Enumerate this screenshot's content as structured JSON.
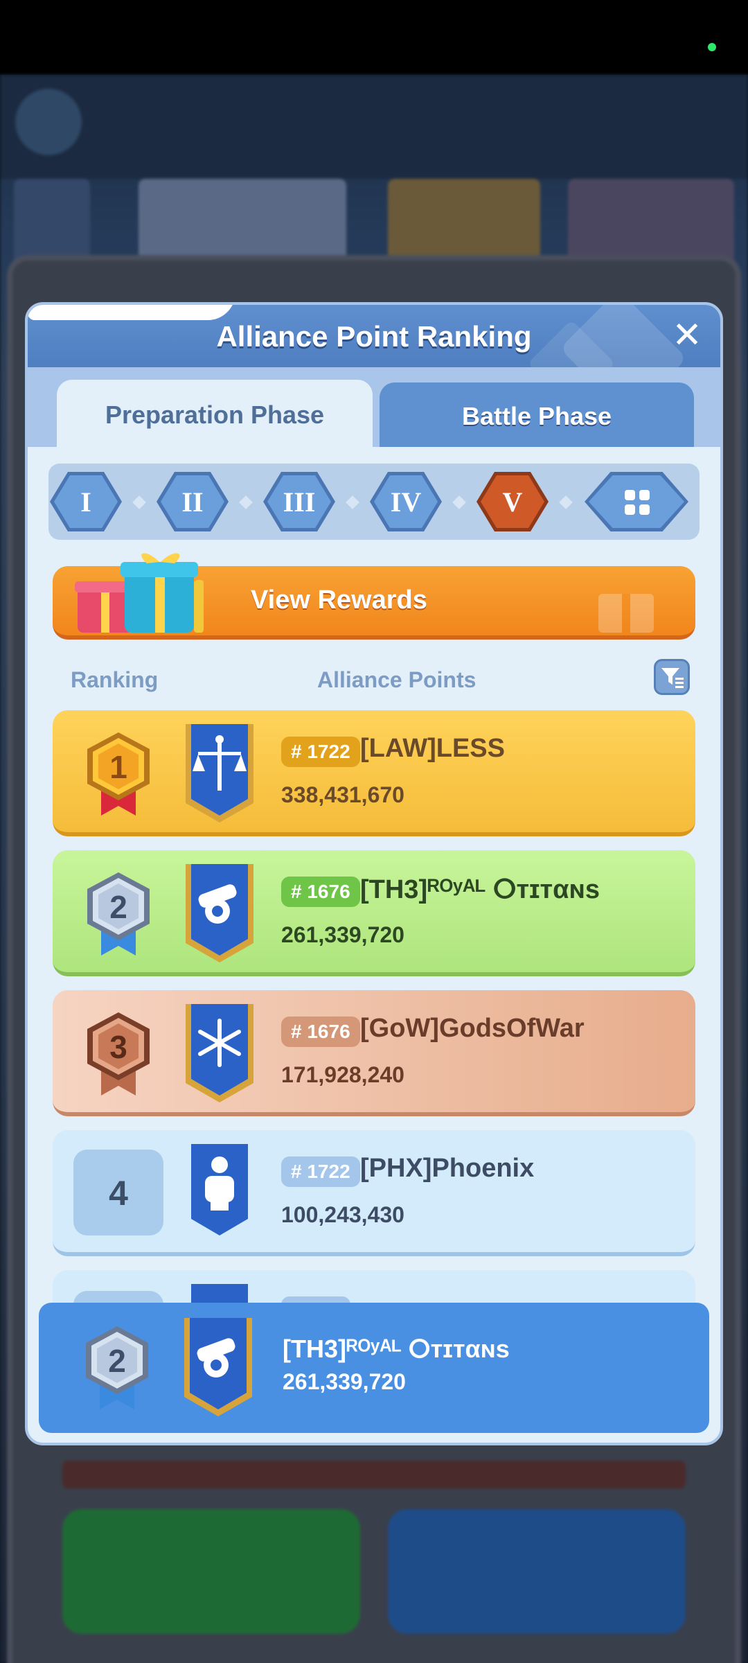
{
  "modal": {
    "title": "Alliance Point Ranking",
    "close_label": "✕"
  },
  "tabs": [
    {
      "label": "Preparation Phase",
      "active": true
    },
    {
      "label": "Battle Phase",
      "active": false
    }
  ],
  "tiers": [
    {
      "label": "I",
      "active": false
    },
    {
      "label": "II",
      "active": false
    },
    {
      "label": "III",
      "active": false
    },
    {
      "label": "IV",
      "active": false
    },
    {
      "label": "V",
      "active": true
    },
    {
      "label": "grid",
      "icon": "grid-icon",
      "active": false
    }
  ],
  "rewards_button": {
    "label": "View Rewards"
  },
  "columns": {
    "ranking": "Ranking",
    "points": "Alliance Points"
  },
  "rows": [
    {
      "rank": "1",
      "server": "# 1722",
      "name": "[LAW]LESS",
      "points": "338,431,670",
      "emblem": "scales-banner-icon"
    },
    {
      "rank": "2",
      "server": "# 1676",
      "name": "[TH3]ᴿᴼʸᴬᴸ ⵔтɪтαɴѕ",
      "points": "261,339,720",
      "emblem": "cannon-banner-icon"
    },
    {
      "rank": "3",
      "server": "# 1676",
      "name": "[GoW]GodsOfWar",
      "points": "171,928,240",
      "emblem": "snowflake-banner-icon"
    },
    {
      "rank": "4",
      "server": "# 1722",
      "name": "[PHX]Phoenix",
      "points": "100,243,430",
      "emblem": "fist-banner-icon"
    }
  ],
  "my_alliance": {
    "rank": "2",
    "name": "[TH3]ᴿᴼʸᴬᴸ ⵔтɪтαɴѕ",
    "points": "261,339,720",
    "emblem": "cannon-banner-icon"
  },
  "colors": {
    "accent_blue": "#4a90e2",
    "gold": "#f5bc3a",
    "silver_row": "#aee57d",
    "bronze_row": "#e7ad8c",
    "active_tier": "#cf5a28"
  }
}
